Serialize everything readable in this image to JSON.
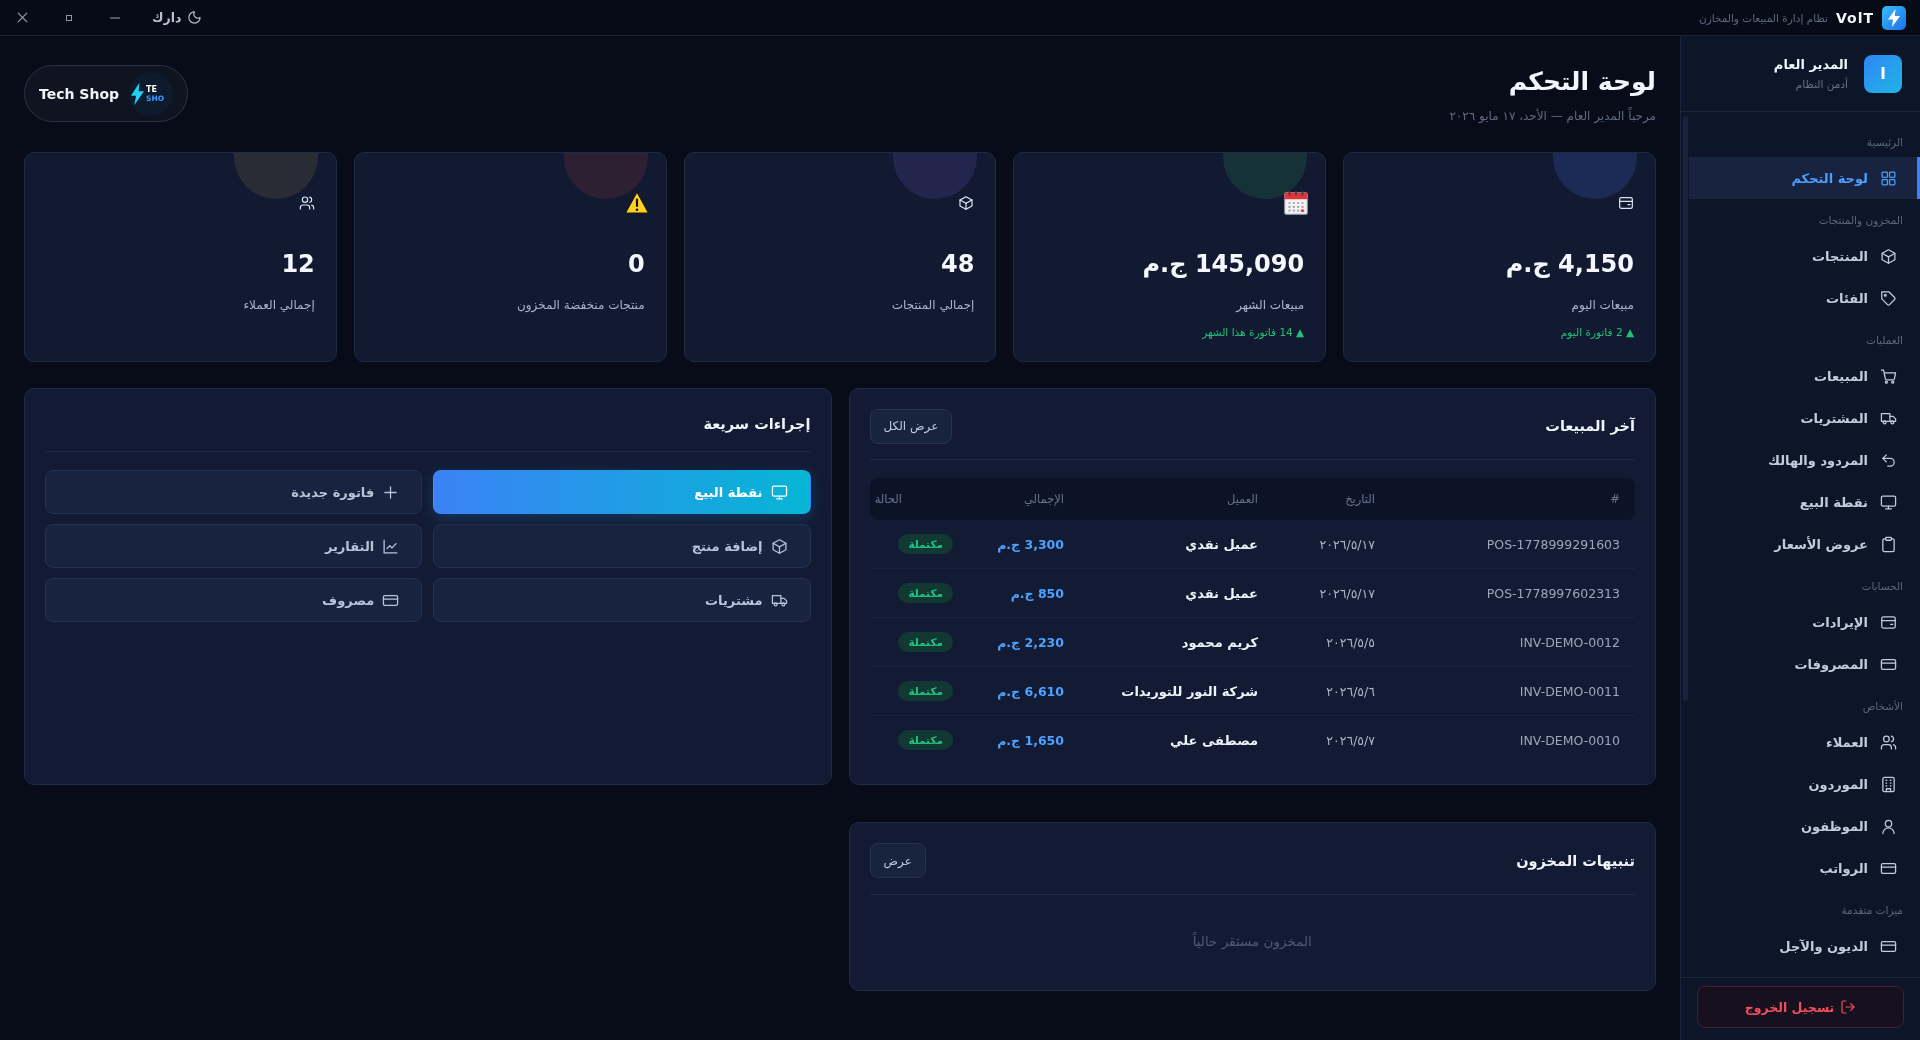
{
  "title_bar": {
    "app_name": "VolT",
    "app_subtitle": "نظام إدارة المبيعات والمخازن",
    "theme_toggle": "دارك"
  },
  "user": {
    "avatar_letter": "I",
    "name": "المدير العام",
    "role": "أدمن النظام"
  },
  "sidebar": {
    "sections": [
      {
        "label": "الرئيسية",
        "items": [
          {
            "label": "لوحة التحكم",
            "selected": true
          }
        ]
      },
      {
        "label": "المخزون والمنتجات",
        "items": [
          {
            "label": "المنتجات",
            "selected": false
          },
          {
            "label": "الفئات",
            "selected": false
          }
        ]
      },
      {
        "label": "العمليات",
        "items": [
          {
            "label": "المبيعات",
            "selected": false
          },
          {
            "label": "المشتريات",
            "selected": false
          },
          {
            "label": "المردود والهالك",
            "selected": false
          },
          {
            "label": "نقطة البيع",
            "selected": false
          },
          {
            "label": "عروض الأسعار",
            "selected": false
          }
        ]
      },
      {
        "label": "الحسابات",
        "items": [
          {
            "label": "الإيرادات",
            "selected": false
          },
          {
            "label": "المصروفات",
            "selected": false
          }
        ]
      },
      {
        "label": "الأشخاص",
        "items": [
          {
            "label": "العملاء",
            "selected": false
          },
          {
            "label": "الموردون",
            "selected": false
          },
          {
            "label": "الموظفون",
            "selected": false
          },
          {
            "label": "الرواتب",
            "selected": false
          }
        ]
      },
      {
        "label": "ميزات متقدمة",
        "items": [
          {
            "label": "الديون والآجل",
            "selected": false
          }
        ]
      }
    ],
    "logout": "تسجيل الخروج"
  },
  "header": {
    "title": "لوحة التحكم",
    "subtitle": "مرحباً المدير العام — الأحد، ١٧ مايو ٢٠٢٦",
    "store": {
      "name": "Tech Shop",
      "logo_text": [
        "TE",
        "SHO"
      ]
    }
  },
  "stats": [
    {
      "value": "4,150 ج.م",
      "label": "مبيعات اليوم",
      "trend": "▲ 2 فاتورة اليوم",
      "color": "#1b2b55"
    },
    {
      "value": "145,090 ج.م",
      "label": "مبيعات الشهر",
      "trend": "▲ 14 فاتورة هذا الشهر",
      "color": "#163238"
    },
    {
      "value": "48",
      "label": "إجمالي المنتجات",
      "color": "#23254c"
    },
    {
      "value": "0",
      "label": "منتجات منخفضة المخزون",
      "color": "#2e2033"
    },
    {
      "value": "12",
      "label": "إجمالي العملاء",
      "color": "#2a2c35"
    }
  ],
  "recent_sales": {
    "title": "آخر المبيعات",
    "view_all": "عرض الكل",
    "columns": [
      "#",
      "التاريخ",
      "العميل",
      "الإجمالي",
      "الحالة"
    ],
    "rows": [
      {
        "id": "POS-1778999291603",
        "date": "٢٠٢٦/٥/١٧",
        "customer": "عميل نقدي",
        "total": "3,300 ج.م",
        "status": "مكتملة"
      },
      {
        "id": "POS-1778997602313",
        "date": "٢٠٢٦/٥/١٧",
        "customer": "عميل نقدي",
        "total": "850 ج.م",
        "status": "مكتملة"
      },
      {
        "id": "INV-DEMO-0012",
        "date": "٢٠٢٦/٥/٥",
        "customer": "كريم محمود",
        "total": "2,230 ج.م",
        "status": "مكتملة"
      },
      {
        "id": "INV-DEMO-0011",
        "date": "٢٠٢٦/٥/٦",
        "customer": "شركة النور للتوريدات",
        "total": "6,610 ج.م",
        "status": "مكتملة"
      },
      {
        "id": "INV-DEMO-0010",
        "date": "٢٠٢٦/٥/٧",
        "customer": "مصطفى علي",
        "total": "1,650 ج.م",
        "status": "مكتملة"
      }
    ]
  },
  "quick_actions": {
    "title": "إجراءات سريعة",
    "actions": [
      {
        "label": "نقطة البيع",
        "kind": "primary"
      },
      {
        "label": "فاتورة جديدة",
        "kind": "secondary"
      },
      {
        "label": "إضافة منتج",
        "kind": "secondary"
      },
      {
        "label": "التقارير",
        "kind": "secondary"
      },
      {
        "label": "مشتريات",
        "kind": "secondary"
      },
      {
        "label": "مصروف",
        "kind": "secondary"
      }
    ]
  },
  "stock_alerts": {
    "title": "تنبيهات المخزون",
    "view": "عرض",
    "empty_message": "المخزون مستقر حالياً"
  }
}
